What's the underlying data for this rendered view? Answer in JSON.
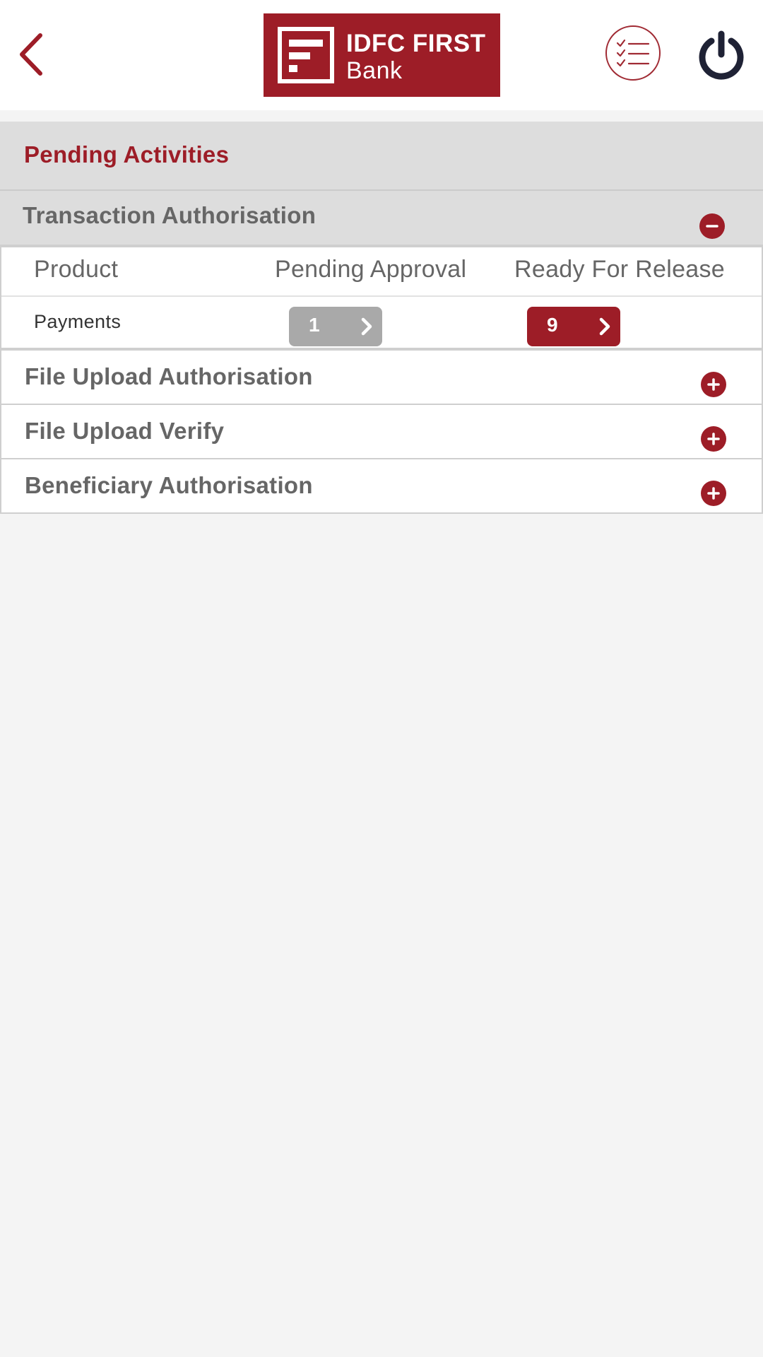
{
  "header": {
    "logo_line1": "IDFC FIRST",
    "logo_line2": "Bank",
    "back_icon": "chevron-left-icon",
    "tasks_icon": "checklist-icon",
    "power_icon": "power-icon"
  },
  "section": {
    "title": "Pending Activities"
  },
  "transaction_authorisation": {
    "title": "Transaction Authorisation",
    "expanded": true,
    "columns": {
      "product": "Product",
      "pending": "Pending Approval",
      "release": "Ready For Release"
    },
    "rows": [
      {
        "product": "Payments",
        "pending": "1",
        "release": "9"
      }
    ]
  },
  "collapsed_sections": [
    {
      "title": "File Upload Authorisation"
    },
    {
      "title": "File Upload Verify"
    },
    {
      "title": "Beneficiary Authorisation"
    }
  ],
  "colors": {
    "brand": "#9d1d27",
    "muted_button": "#a9a9a9",
    "section_bg": "#dddddd",
    "page_bg": "#f4f4f4"
  }
}
